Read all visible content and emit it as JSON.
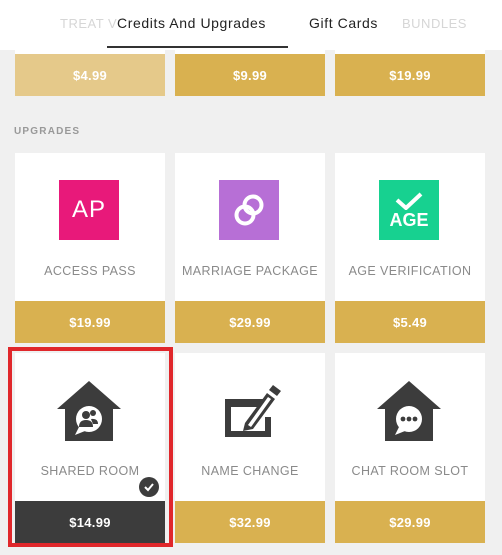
{
  "tabs": {
    "ghost_left": "TREAT V",
    "ghost_right": "BUNDLES",
    "credits_label": "Credits And Upgrades",
    "gift_label": "Gift Cards"
  },
  "credits_row": {
    "prices": [
      "$4.99",
      "$9.99",
      "$19.99"
    ]
  },
  "upgrades": {
    "section_label": "UPGRADES",
    "items": [
      {
        "label": "ACCESS PASS",
        "price": "$19.99",
        "icon": "access-pass-icon",
        "icon_text": "AP",
        "color": "#e8197a"
      },
      {
        "label": "MARRIAGE PACKAGE",
        "price": "$29.99",
        "icon": "rings-icon",
        "color": "#b76fd6"
      },
      {
        "label": "AGE VERIFICATION",
        "price": "$5.49",
        "icon": "age-verification-icon",
        "icon_text": "AGE",
        "color": "#17d190"
      },
      {
        "label": "SHARED ROOM",
        "price": "$14.99",
        "icon": "shared-room-icon",
        "selected": true
      },
      {
        "label": "NAME CHANGE",
        "price": "$32.99",
        "icon": "name-change-icon"
      },
      {
        "label": "CHAT ROOM SLOT",
        "price": "$29.99",
        "icon": "chat-room-icon"
      }
    ]
  },
  "colors": {
    "gold": "#d9b150",
    "gold_light": "#e5c98a",
    "dark": "#3c3c3c",
    "highlight": "#e0272b"
  }
}
